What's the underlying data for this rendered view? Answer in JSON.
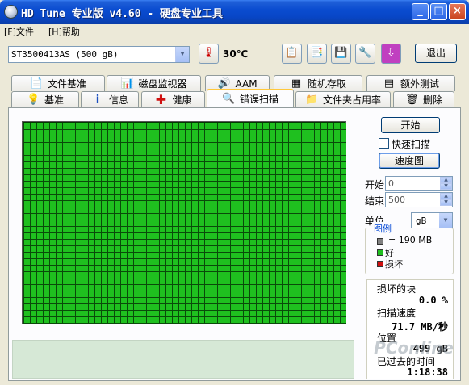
{
  "window": {
    "title": "HD Tune 专业版 v4.60 - 硬盘专业工具",
    "minimize": "_",
    "maximize": "□",
    "close": "×"
  },
  "menu": {
    "file": "[F]文件",
    "help": "[H]帮助"
  },
  "toolbar": {
    "drive": "ST3500413AS (500 gB)",
    "temperature": "30℃",
    "exit": "退出"
  },
  "tabs_top": [
    {
      "label": "文件基准",
      "icon": "document-icon"
    },
    {
      "label": "磁盘监视器",
      "icon": "chart-icon"
    },
    {
      "label": "AAM",
      "icon": "speaker-icon"
    },
    {
      "label": "随机存取",
      "icon": "random-icon"
    },
    {
      "label": "额外测试",
      "icon": "grid-icon"
    }
  ],
  "tabs_bottom": [
    {
      "label": "基准",
      "icon": "bulb-icon"
    },
    {
      "label": "信息",
      "icon": "info-icon"
    },
    {
      "label": "健康",
      "icon": "plus-icon"
    },
    {
      "label": "错误扫描",
      "icon": "magnifier-icon",
      "active": true
    },
    {
      "label": "文件夹占用率",
      "icon": "folder-icon"
    },
    {
      "label": "删除",
      "icon": "trash-icon"
    }
  ],
  "controls": {
    "start_button": "开始",
    "quick_scan": "快速扫描",
    "speed_map": "速度图",
    "start_label": "开始",
    "start_value": "0",
    "end_label": "结束",
    "end_value": "500",
    "unit_label": "单位",
    "unit_value": "gB"
  },
  "legend": {
    "title": "图例",
    "block_size": "= 190 MB",
    "good": "好",
    "bad": "损坏",
    "colors": {
      "block": "#808080",
      "good": "#1fc01f",
      "bad": "#d01010"
    }
  },
  "stats": {
    "damaged_blocks_label": "损坏的块",
    "damaged_blocks_value": "0.0 %",
    "scan_speed_label": "扫描速度",
    "scan_speed_value": "71.7 MB/秒",
    "position_label": "位置",
    "position_value": "499 gB",
    "elapsed_label": "已过去的时间",
    "elapsed_value": "1:18:38"
  },
  "watermark": "PConline"
}
